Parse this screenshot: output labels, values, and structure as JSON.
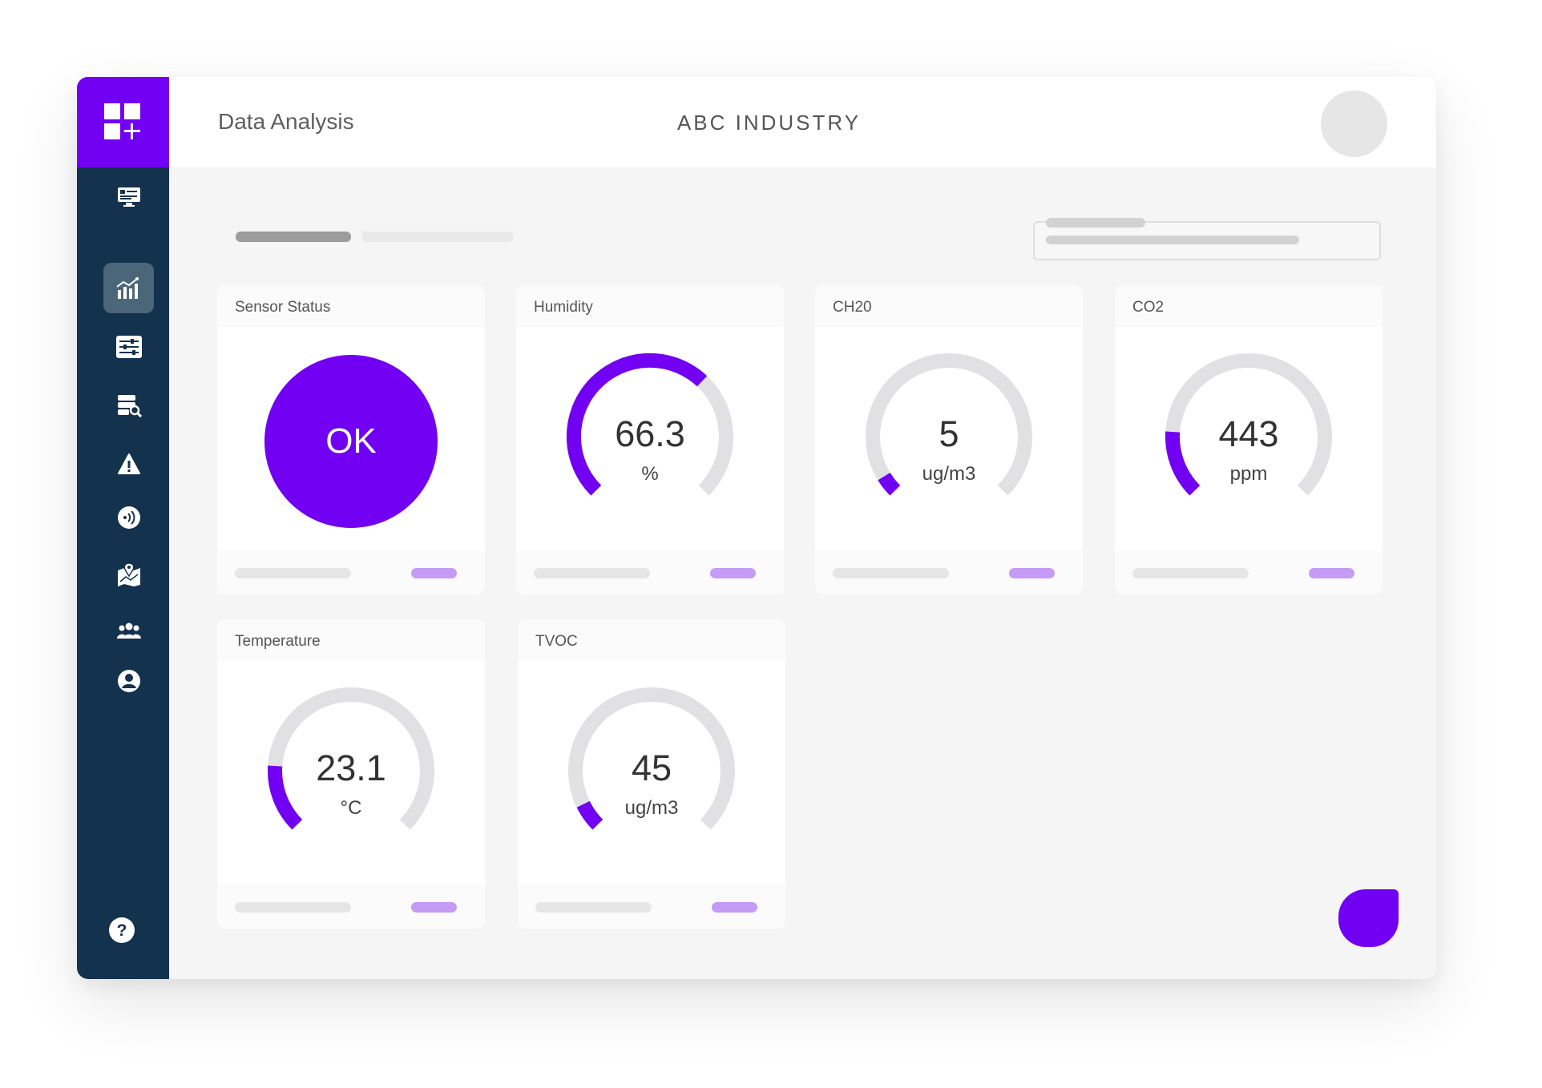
{
  "header": {
    "title": "Data Analysis",
    "company": "ABC INDUSTRY"
  },
  "sidebar": {
    "items": [
      {
        "icon": "dashboard-monitor-icon",
        "active": false
      },
      {
        "icon": "analytics-chart-icon",
        "active": true
      },
      {
        "icon": "sliders-settings-icon",
        "active": false
      },
      {
        "icon": "database-search-icon",
        "active": false
      },
      {
        "icon": "warning-icon",
        "active": false
      },
      {
        "icon": "wireless-signal-icon",
        "active": false
      },
      {
        "icon": "map-location-icon",
        "active": false
      },
      {
        "icon": "users-group-icon",
        "active": false
      },
      {
        "icon": "user-profile-icon",
        "active": false
      }
    ],
    "help_icon": "help-icon"
  },
  "cards": {
    "sensor_status": {
      "title": "Sensor Status",
      "value": "OK"
    },
    "humidity": {
      "title": "Humidity",
      "value": "66.3",
      "unit": "%",
      "level": 0.66
    },
    "ch20": {
      "title": "CH20",
      "value": "5",
      "unit": "ug/m3",
      "level": 0.05
    },
    "co2": {
      "title": "CO2",
      "value": "443",
      "unit": "ppm",
      "level": 0.18
    },
    "temperature": {
      "title": "Temperature",
      "value": "23.1",
      "unit": "°C",
      "level": 0.18
    },
    "tvoc": {
      "title": "TVOC",
      "value": "45",
      "unit": "ug/m3",
      "level": 0.07
    }
  },
  "colors": {
    "accent": "#7200f2",
    "sidebar": "#13324e",
    "gauge_track": "#e1e1e3",
    "pill": "#c59bf5"
  }
}
